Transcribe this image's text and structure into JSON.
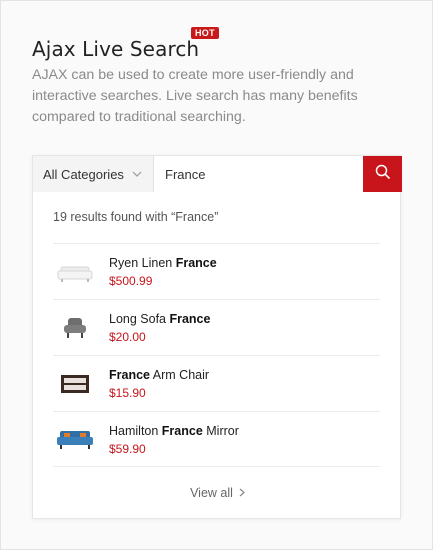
{
  "header": {
    "title": "Ajax Live Search",
    "badge": "HOT",
    "description": "AJAX can be used to create more user-friendly and interactive searches. Live search has many benefits compared to traditional searching."
  },
  "search": {
    "category": "All Categories",
    "query": "France",
    "results_text": "19 results found with “France”"
  },
  "results": [
    {
      "pre": "Ryen Linen ",
      "match": "France",
      "post": "",
      "price": "$500.99",
      "icon": "white-sofa-icon"
    },
    {
      "pre": "Long Sofa ",
      "match": "France",
      "post": "",
      "price": "$20.00",
      "icon": "gray-armchair-icon"
    },
    {
      "pre": "",
      "match": "France",
      "post": " Arm Chair",
      "price": "$15.90",
      "icon": "dark-dresser-icon"
    },
    {
      "pre": "Hamilton ",
      "match": "France",
      "post": " Mirror",
      "price": "$59.90",
      "icon": "blue-sofa-icon"
    }
  ],
  "footer": {
    "view_all": "View all"
  },
  "colors": {
    "accent": "#c8141b",
    "badge": "#c81a1a"
  }
}
